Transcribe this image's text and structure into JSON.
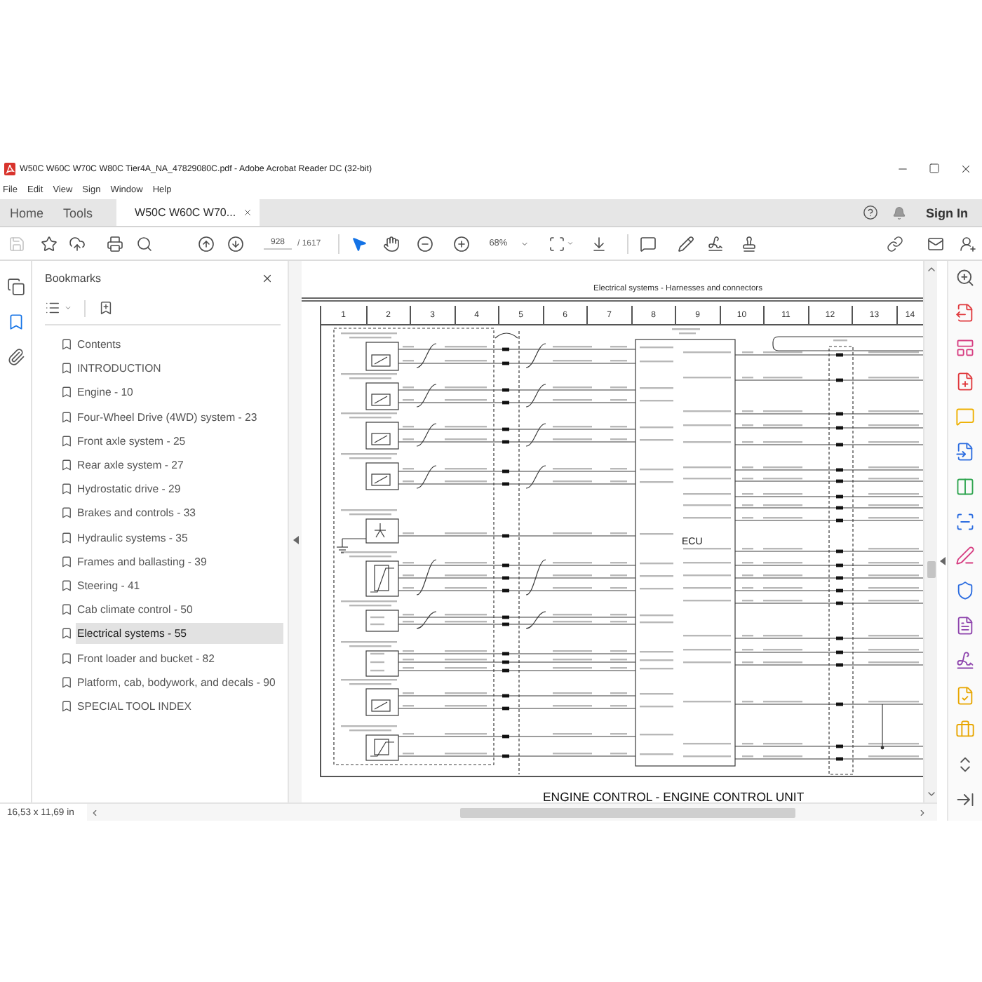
{
  "window": {
    "title": "W50C W60C W70C W80C Tier4A_NA_47829080C.pdf - Adobe Acrobat Reader DC (32-bit)"
  },
  "menu": [
    "File",
    "Edit",
    "View",
    "Sign",
    "Window",
    "Help"
  ],
  "tabs": [
    {
      "label": "Home",
      "kind": "nav",
      "selected": false
    },
    {
      "label": "Tools",
      "kind": "nav",
      "selected": false
    },
    {
      "label": "W50C W60C W70...",
      "kind": "document",
      "selected": true
    }
  ],
  "account": {
    "sign_in": "Sign In"
  },
  "toolbar": {
    "save": {
      "disabled": true
    },
    "page": "928",
    "page_count": "/ 1617",
    "cursor_tools": [
      {
        "kind": "pointer",
        "selected": true
      },
      {
        "kind": "hand",
        "selected": false
      }
    ],
    "zoom": "68%"
  },
  "side_rail": [
    {
      "kind": "pages",
      "selected": false
    },
    {
      "kind": "bookmarks",
      "selected": true
    },
    {
      "kind": "attachments",
      "selected": false
    }
  ],
  "bookmarks": {
    "title": "Bookmarks",
    "items": [
      {
        "label": "Contents",
        "selected": false
      },
      {
        "label": "INTRODUCTION",
        "selected": false
      },
      {
        "label": "Engine - 10",
        "selected": false
      },
      {
        "label": "Four-Wheel Drive (4WD) system - 23",
        "selected": false
      },
      {
        "label": "Front axle system - 25",
        "selected": false
      },
      {
        "label": "Rear axle system - 27",
        "selected": false
      },
      {
        "label": "Hydrostatic drive - 29",
        "selected": false
      },
      {
        "label": "Brakes and controls - 33",
        "selected": false
      },
      {
        "label": "Hydraulic systems - 35",
        "selected": false
      },
      {
        "label": "Frames and ballasting - 39",
        "selected": false
      },
      {
        "label": "Steering - 41",
        "selected": false
      },
      {
        "label": "Cab climate control - 50",
        "selected": false
      },
      {
        "label": "Electrical systems - 55",
        "selected": true
      },
      {
        "label": "Front loader and bucket - 82",
        "selected": false
      },
      {
        "label": "Platform, cab, bodywork, and decals - 90",
        "selected": false
      },
      {
        "label": "SPECIAL TOOL INDEX",
        "selected": false
      }
    ]
  },
  "document": {
    "header": "Electrical systems - Harnesses and connectors",
    "columns": [
      "1",
      "2",
      "3",
      "4",
      "5",
      "6",
      "7",
      "8",
      "9",
      "10",
      "11",
      "12",
      "13",
      "14"
    ],
    "diagram_label": "ECU",
    "title": "ENGINE CONTROL - ENGINE CONTROL UNIT"
  },
  "status_bar": {
    "page_size": "16,53 x 11,69 in"
  }
}
